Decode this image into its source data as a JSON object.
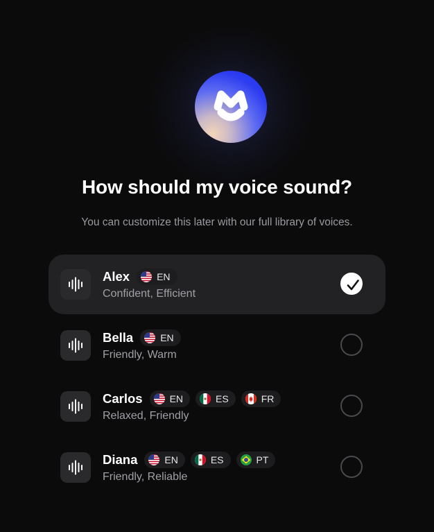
{
  "header": {
    "title": "How should my voice sound?",
    "subtitle": "You can customize this later with our full library of voices."
  },
  "voices": [
    {
      "name": "Alex",
      "description": "Confident, Efficient",
      "selected": true,
      "languages": [
        {
          "code": "EN",
          "flag": "us-flag-icon"
        }
      ]
    },
    {
      "name": "Bella",
      "description": "Friendly, Warm",
      "selected": false,
      "languages": [
        {
          "code": "EN",
          "flag": "us-flag-icon"
        }
      ]
    },
    {
      "name": "Carlos",
      "description": "Relaxed, Friendly",
      "selected": false,
      "languages": [
        {
          "code": "EN",
          "flag": "us-flag-icon"
        },
        {
          "code": "ES",
          "flag": "mexico-flag-icon"
        },
        {
          "code": "FR",
          "flag": "canada-flag-icon"
        }
      ]
    },
    {
      "name": "Diana",
      "description": "Friendly, Reliable",
      "selected": false,
      "languages": [
        {
          "code": "EN",
          "flag": "us-flag-icon"
        },
        {
          "code": "ES",
          "flag": "mexico-flag-icon"
        },
        {
          "code": "PT",
          "flag": "brazil-flag-icon"
        }
      ]
    }
  ],
  "colors": {
    "background": "#0b0b0c",
    "selected_row": "#222224",
    "logo_blue": "#2c3cf0",
    "logo_peach": "#f3d6b8"
  }
}
